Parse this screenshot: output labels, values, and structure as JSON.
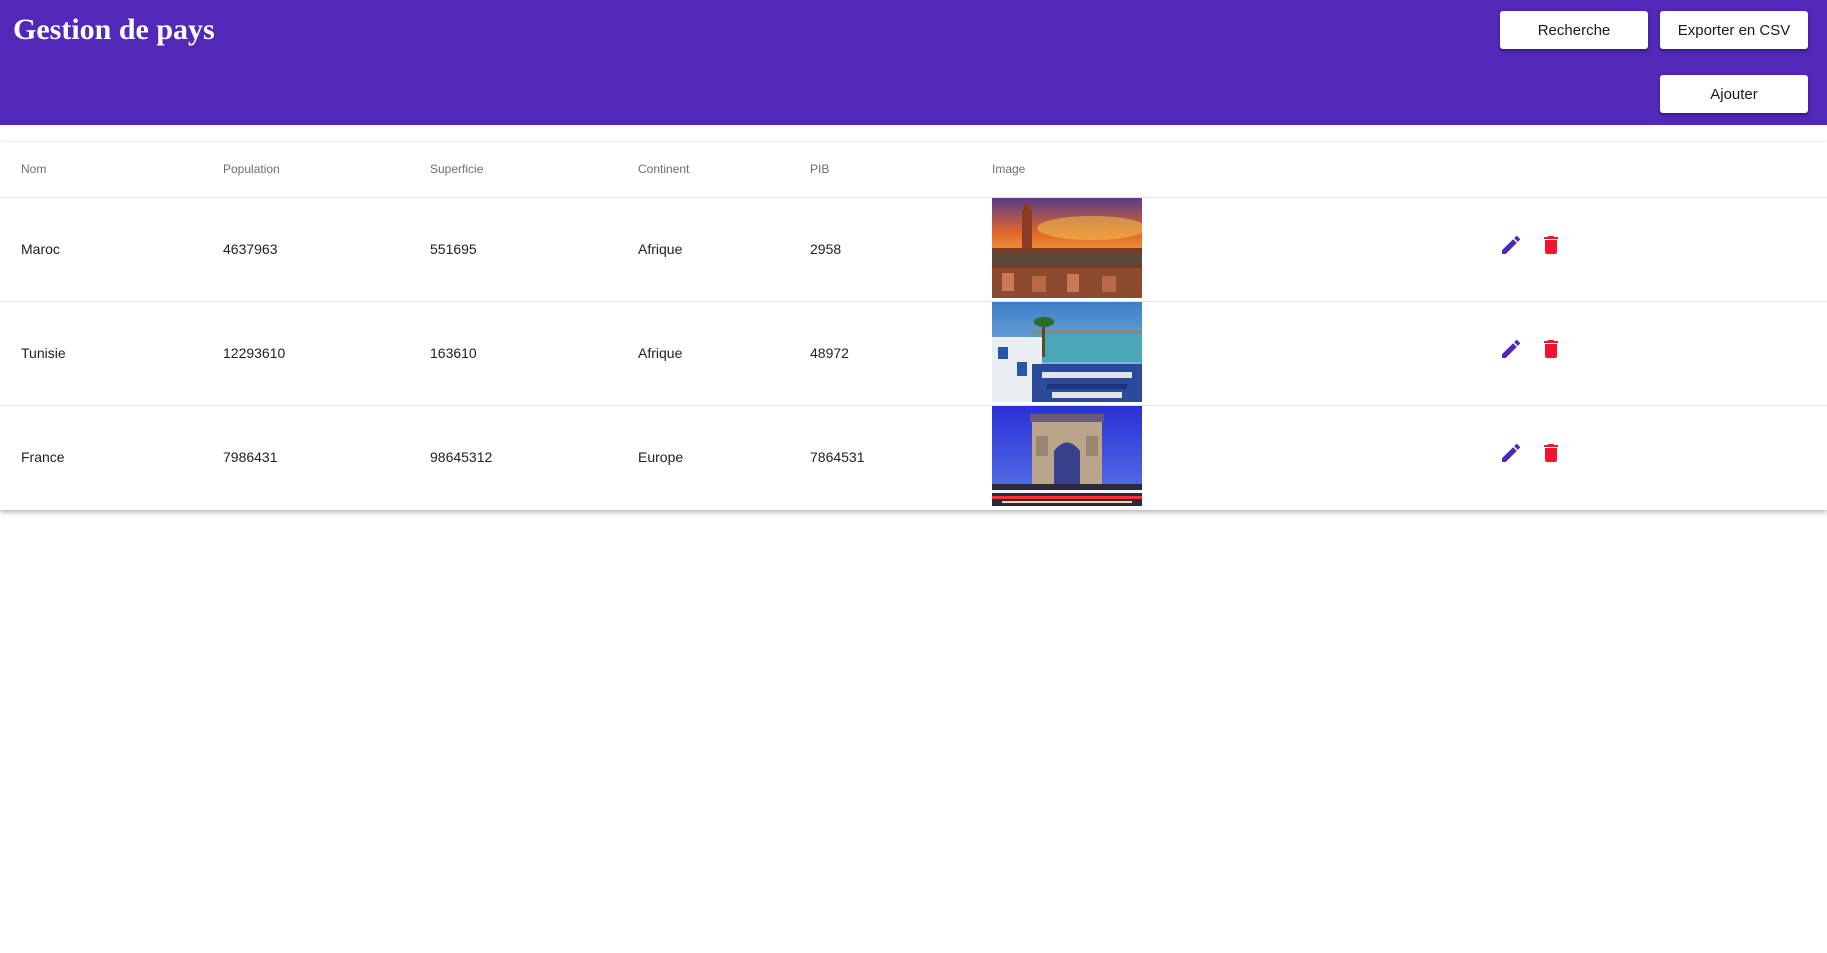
{
  "header": {
    "title": "Gestion de pays",
    "search_label": "Recherche",
    "export_label": "Exporter en CSV",
    "add_label": "Ajouter"
  },
  "table": {
    "columns": [
      "Nom",
      "Population",
      "Superficie",
      "Continent",
      "PIB",
      "Image"
    ],
    "rows": [
      {
        "nom": "Maroc",
        "population": "4637963",
        "superficie": "551695",
        "continent": "Afrique",
        "pib": "2958",
        "image": "marrakech-sunset-photo"
      },
      {
        "nom": "Tunisie",
        "population": "12293610",
        "superficie": "163610",
        "continent": "Afrique",
        "pib": "48972",
        "image": "sidi-bou-said-coast-photo"
      },
      {
        "nom": "France",
        "population": "7986431",
        "superficie": "98645312",
        "continent": "Europe",
        "pib": "7864531",
        "image": "arc-de-triomphe-photo"
      }
    ]
  },
  "icons": {
    "edit": "pencil-icon",
    "delete": "trash-icon"
  },
  "colors": {
    "header_bg": "#5228b8",
    "edit_icon": "#5228b8",
    "delete_icon": "#f0142f"
  }
}
